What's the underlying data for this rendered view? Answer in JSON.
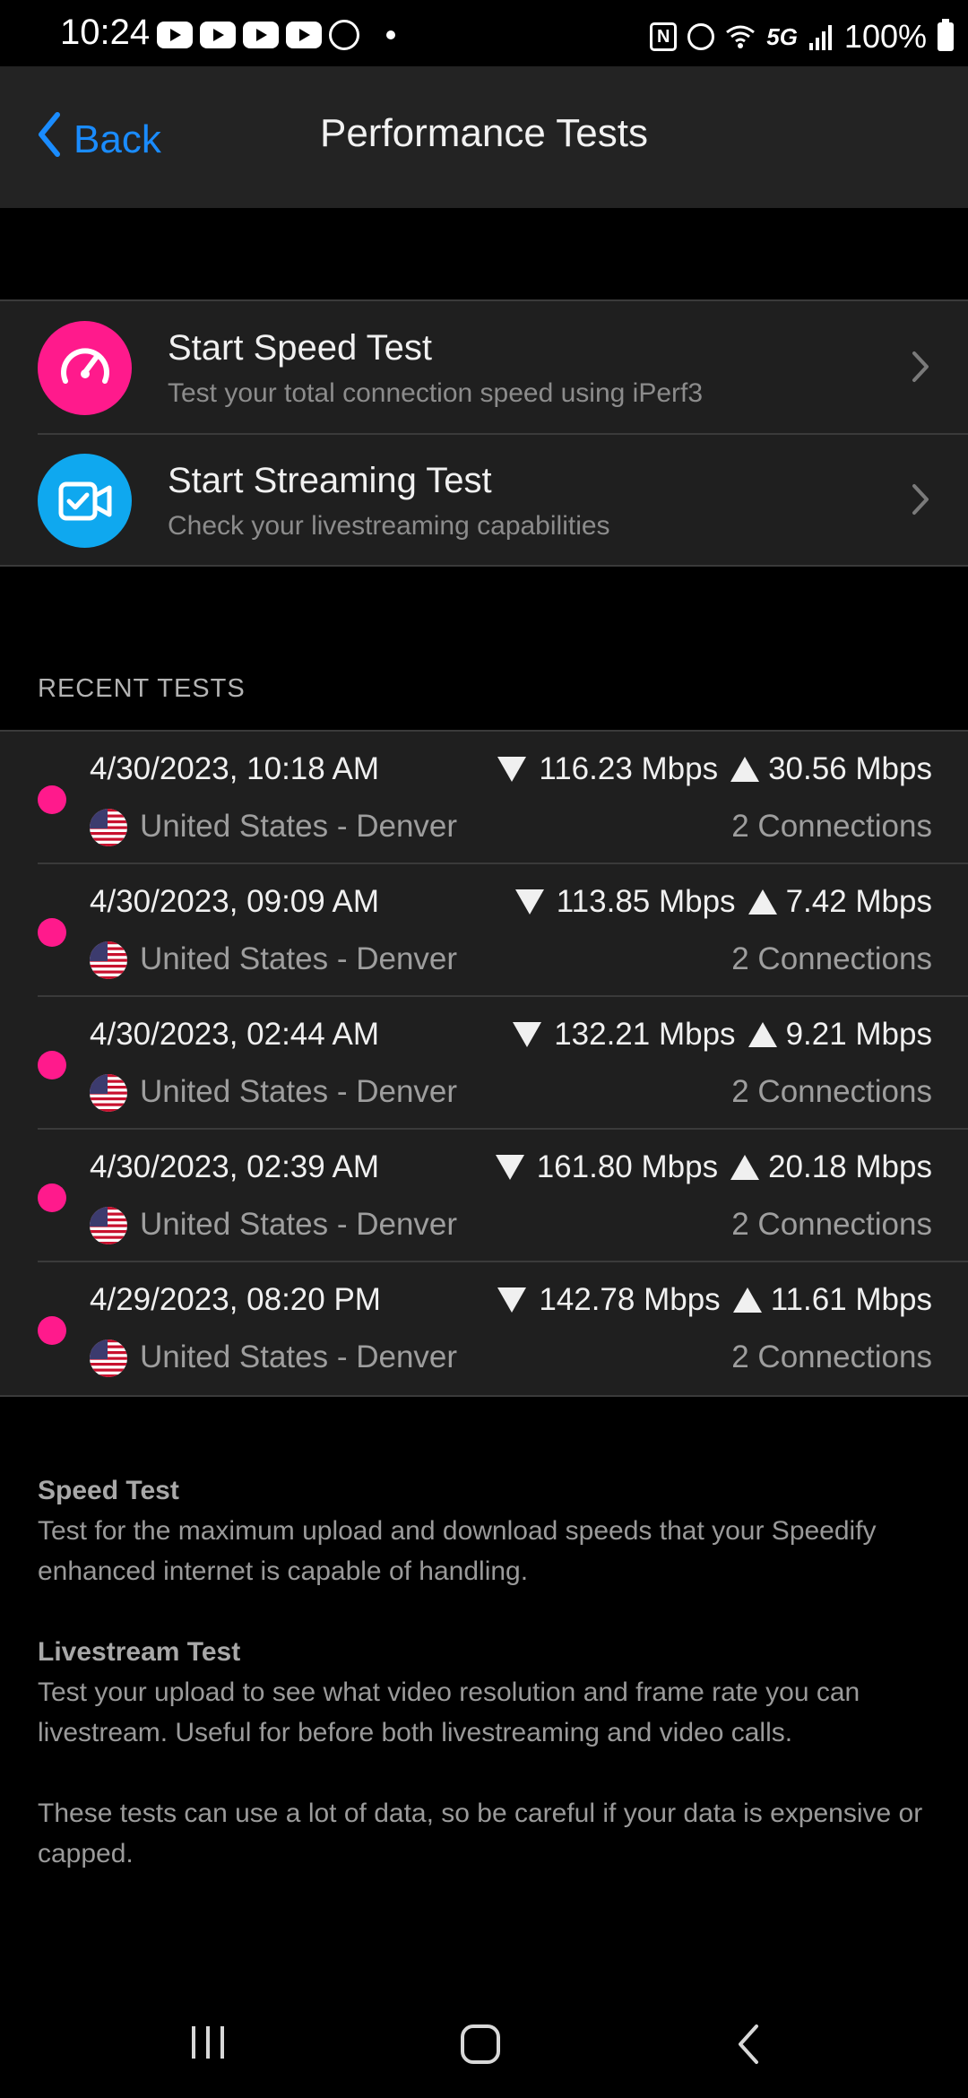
{
  "status_bar": {
    "time": "10:24",
    "battery": "100%",
    "network": "5G",
    "nfc": "N",
    "notification_icons": [
      "youtube-icon",
      "youtube-icon",
      "youtube-icon",
      "youtube-icon",
      "app-icon"
    ]
  },
  "nav": {
    "back_label": "Back",
    "title": "Performance Tests"
  },
  "tests": [
    {
      "title": "Start Speed Test",
      "subtitle": "Test your total connection speed using iPerf3",
      "icon": "speedometer-icon",
      "color": "#ff1a8c"
    },
    {
      "title": "Start Streaming Test",
      "subtitle": "Check your livestreaming capabilities",
      "icon": "video-check-icon",
      "color": "#0fa8ef"
    }
  ],
  "recent": {
    "header": "RECENT TESTS",
    "items": [
      {
        "date": "4/30/2023, 10:18 AM",
        "download": "116.23 Mbps",
        "upload": "30.56 Mbps",
        "location": "United States - Denver",
        "connections": "2 Connections"
      },
      {
        "date": "4/30/2023, 09:09 AM",
        "download": "113.85 Mbps",
        "upload": "7.42 Mbps",
        "location": "United States - Denver",
        "connections": "2 Connections"
      },
      {
        "date": "4/30/2023, 02:44 AM",
        "download": "132.21 Mbps",
        "upload": "9.21 Mbps",
        "location": "United States - Denver",
        "connections": "2 Connections"
      },
      {
        "date": "4/30/2023, 02:39 AM",
        "download": "161.80 Mbps",
        "upload": "20.18 Mbps",
        "location": "United States - Denver",
        "connections": "2 Connections"
      },
      {
        "date": "4/29/2023, 08:20 PM",
        "download": "142.78 Mbps",
        "upload": "11.61 Mbps",
        "location": "United States - Denver",
        "connections": "2 Connections"
      }
    ]
  },
  "info": {
    "speed_heading": "Speed Test",
    "speed_text": "Test for the maximum upload and download speeds that your Speedify enhanced internet is capable of handling.",
    "live_heading": "Livestream Test",
    "live_text": "Test your upload to see what video resolution and frame rate you can livestream. Useful for before both livestreaming and video calls.",
    "warning": "These tests can use a lot of data, so be careful if your data is expensive or capped."
  },
  "colors": {
    "accent_link": "#1a8cff",
    "status_dot": "#ff1a8c",
    "speed_icon_bg": "#ff1a8c",
    "stream_icon_bg": "#0fa8ef"
  }
}
